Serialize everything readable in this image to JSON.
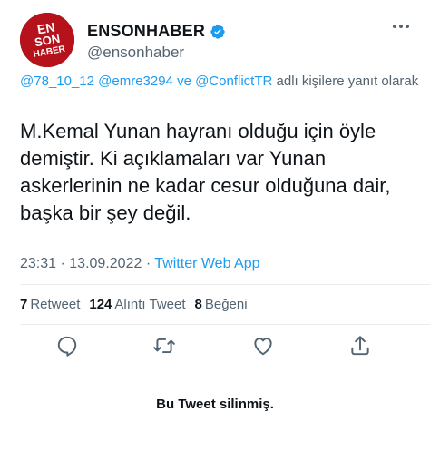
{
  "account": {
    "display_name": "ENSONHABER",
    "handle": "@ensonhaber",
    "logo_text": [
      "EN",
      "SON",
      "HABER"
    ],
    "verified_color": "#1d9bf0",
    "brand_color": "#b5121b"
  },
  "reply": {
    "mention_1": "@78_10_12",
    "mention_2": "@emre3294",
    "connector": "ve",
    "mention_3": "@ConflictTR",
    "suffix": "adlı kişilere yanıt olarak"
  },
  "tweet": {
    "text": "M.Kemal Yunan hayranı olduğu için öyle demiştir. Ki açıklamaları var Yunan askerlerinin ne kadar cesur olduğuna dair, başka bir şey değil.",
    "time": "23:31",
    "separator_1": "·",
    "date": "13.09.2022",
    "separator_2": "·",
    "source": "Twitter Web App"
  },
  "stats": {
    "retweets_count": "7",
    "retweets_label": "Retweet",
    "quotes_count": "124",
    "quotes_label": "Alıntı Tweet",
    "likes_count": "8",
    "likes_label": "Beğeni"
  },
  "actions": [
    "reply-icon",
    "retweet-icon",
    "like-icon",
    "share-icon"
  ],
  "footer": {
    "deleted_notice": "Bu Tweet silinmiş."
  }
}
